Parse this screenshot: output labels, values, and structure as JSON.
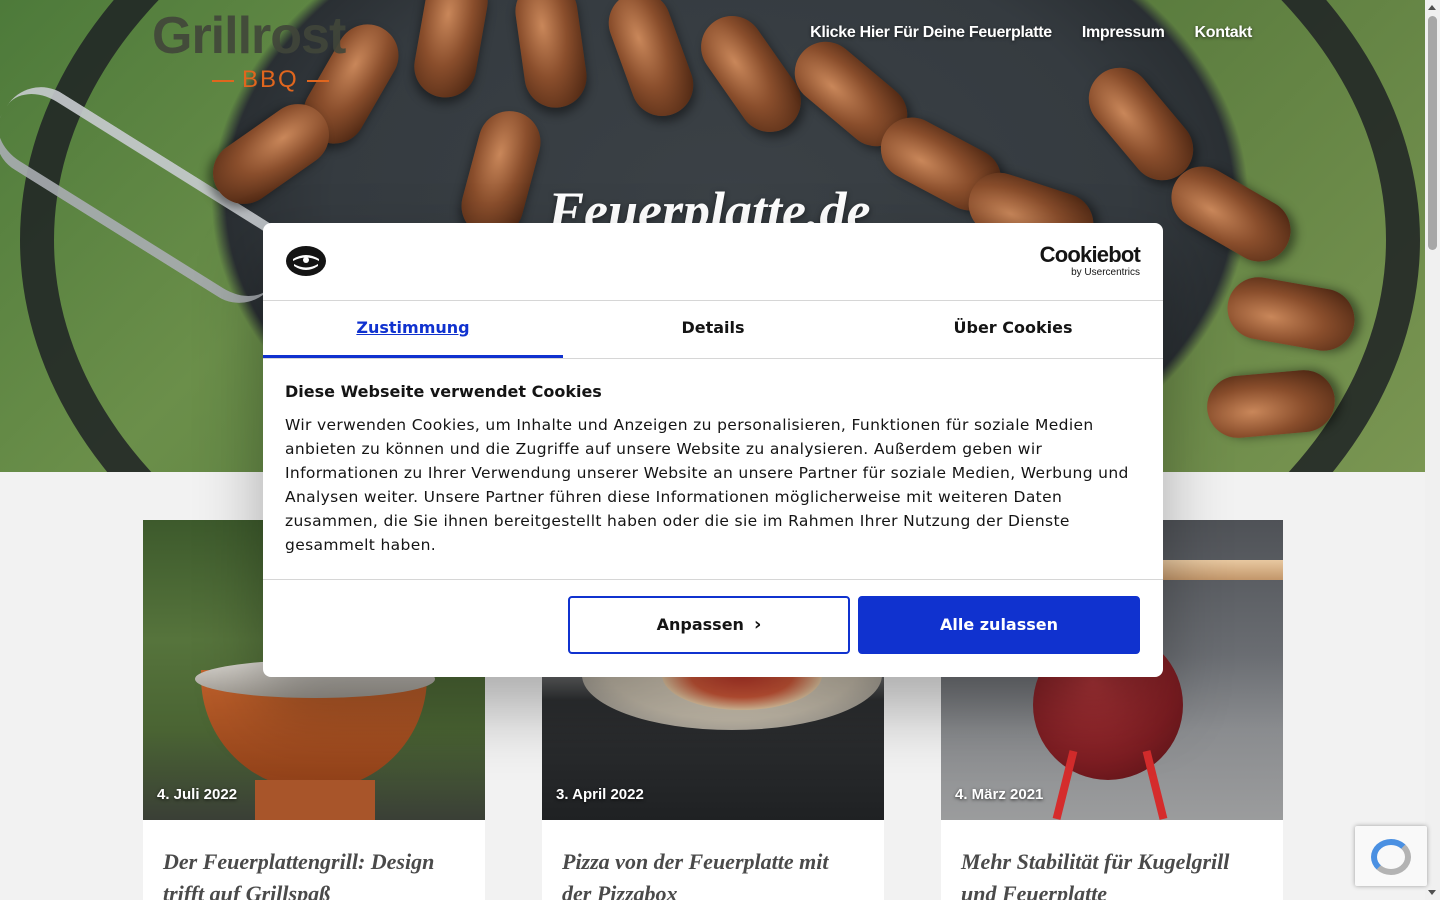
{
  "site": {
    "logo_text": "Grillrost",
    "logo_sub": "BBQ",
    "hero_title": "Feuerplatte.de"
  },
  "nav": {
    "items": [
      {
        "label": "Klicke Hier Für Deine Feuerplatte"
      },
      {
        "label": "Impressum"
      },
      {
        "label": "Kontakt"
      }
    ]
  },
  "cards": [
    {
      "date": "4. Juli 2022",
      "title": "Der Feuerplattengrill: Design trifft auf Grillspaß"
    },
    {
      "date": "3. April 2022",
      "title": "Pizza von der Feuerplatte mit der Pizzabox"
    },
    {
      "date": "4. März 2021",
      "title": "Mehr Stabilität für Kugelgrill und Feuerplatte"
    }
  ],
  "cookie_dialog": {
    "brand": "Cookiebot",
    "brand_sub": "by Usercentrics",
    "tabs": [
      {
        "label": "Zustimmung",
        "active": true
      },
      {
        "label": "Details",
        "active": false
      },
      {
        "label": "Über Cookies",
        "active": false
      }
    ],
    "heading": "Diese Webseite verwendet Cookies",
    "text": "Wir verwenden Cookies, um Inhalte und Anzeigen zu personalisieren, Funktionen für soziale Medien anbieten zu können und die Zugriffe auf unsere Website zu analysieren. Außerdem geben wir Informationen zu Ihrer Verwendung unserer Website an unsere Partner für soziale Medien, Werbung und Analysen weiter. Unsere Partner führen diese Informationen möglicherweise mit weiteren Daten zusammen, die Sie ihnen bereitgestellt haben oder die sie im Rahmen Ihrer Nutzung der Dienste gesammelt haben.",
    "customize_label": "Anpassen",
    "allow_all_label": "Alle zulassen"
  },
  "colors": {
    "accent": "#1032cf",
    "logo_orange": "#e0661e",
    "page_bg": "#f2f2f2"
  }
}
